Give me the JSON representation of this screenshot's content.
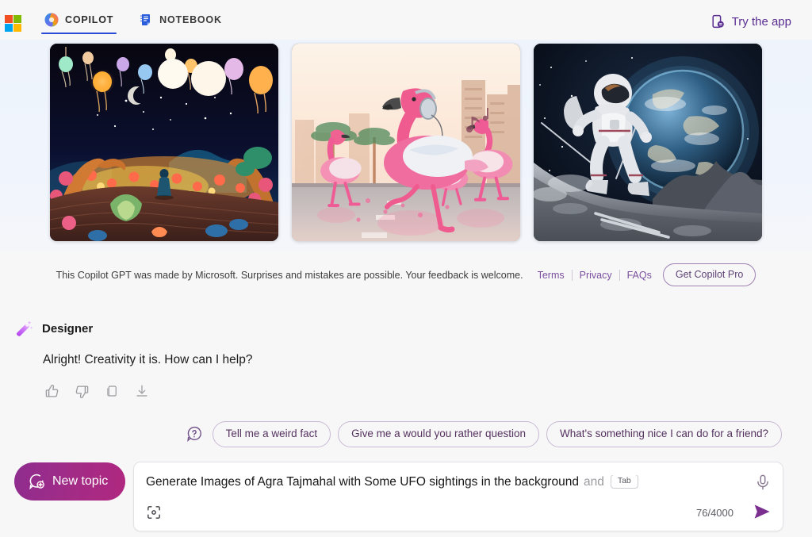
{
  "header": {
    "logo": "microsoft-logo",
    "tabs": [
      {
        "label": "COPILOT",
        "icon": "copilot-icon",
        "active": true
      },
      {
        "label": "NOTEBOOK",
        "icon": "notebook-icon",
        "active": false
      }
    ],
    "try_app": {
      "label": "Try the app",
      "icon": "mobile-app-icon"
    }
  },
  "gallery": {
    "images": [
      {
        "alt": "Glowing lanterns over a colorful fantasy night garden with a small figure"
      },
      {
        "alt": "Dancing pink flamingos wearing headphones on a city street at sunset"
      },
      {
        "alt": "Astronaut skiing on the moon with Earth rising in the background"
      }
    ]
  },
  "disclaimer": {
    "text": "This Copilot GPT was made by Microsoft. Surprises and mistakes are possible. Your feedback is welcome.",
    "links": [
      "Terms",
      "Privacy",
      "FAQs"
    ],
    "pro_button": "Get Copilot Pro"
  },
  "message": {
    "author": "Designer",
    "avatar_icon": "magic-wand-icon",
    "body": "Alright! Creativity it is. How can I help?",
    "actions": [
      "thumbs-up-icon",
      "thumbs-down-icon",
      "copy-icon",
      "download-icon"
    ]
  },
  "suggestions": {
    "icon": "question-bubble-icon",
    "chips": [
      "Tell me a weird fact",
      "Give me a would you rather question",
      "What's something nice I can do for a friend?"
    ]
  },
  "composer": {
    "new_topic_label": "New topic",
    "new_topic_icon": "new-chat-icon",
    "input_value": "Generate  Images of Agra Tajmahal with Some UFO sightings in the background",
    "ghost_suggestion": "and",
    "tab_hint": "Tab",
    "counter": "76/4000",
    "mic_icon": "microphone-icon",
    "visual_search_icon": "visual-search-icon",
    "send_icon": "send-icon"
  },
  "colors": {
    "accent_purple": "#5a2d91",
    "tab_underline_blue": "#2b4ad6",
    "new_topic_gradient_start": "#8e2d8e",
    "new_topic_gradient_end": "#b0287f",
    "page_background": "#f7f7f8",
    "gallery_background": "#eef3fc"
  }
}
